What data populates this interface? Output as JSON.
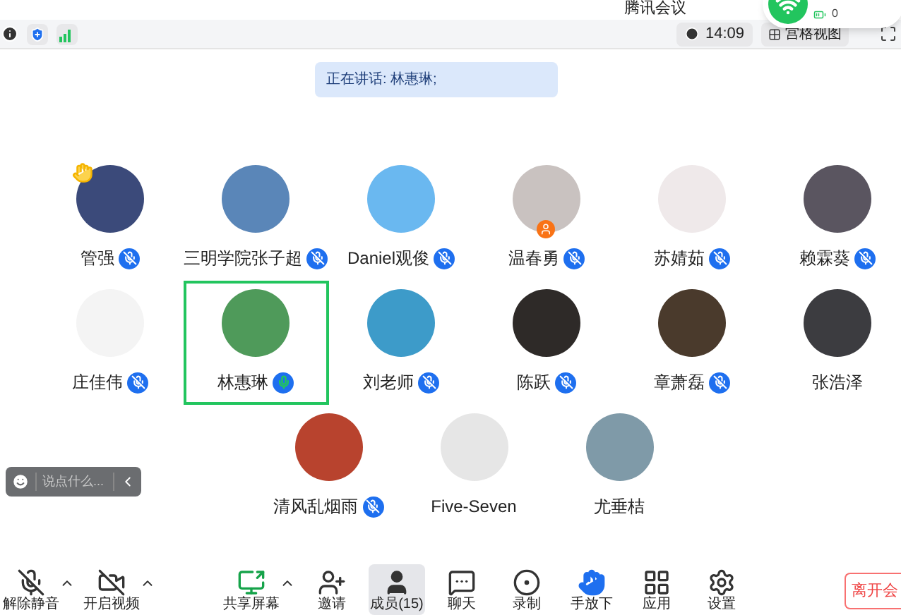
{
  "window": {
    "title": "腾讯会议"
  },
  "top_bar": {
    "time": "14:09",
    "view_button": "宫格视图"
  },
  "network_popup": {
    "count": "0"
  },
  "speaking_banner": "正在讲话: 林惠琳;",
  "participants": [
    {
      "name": "管强",
      "muted": true,
      "speaking": false,
      "selected": false,
      "hand_raised": true,
      "host": false,
      "color": "#3b4a7a"
    },
    {
      "name": "三明学院张子超",
      "muted": true,
      "speaking": false,
      "selected": false,
      "hand_raised": false,
      "host": false,
      "color": "#5a86b8"
    },
    {
      "name": "Daniel观俊",
      "muted": true,
      "speaking": false,
      "selected": false,
      "hand_raised": false,
      "host": false,
      "color": "#6ab8f0"
    },
    {
      "name": "温春勇",
      "muted": true,
      "speaking": false,
      "selected": false,
      "hand_raised": false,
      "host": true,
      "color": "#c9c2c0"
    },
    {
      "name": "苏婧茹",
      "muted": true,
      "speaking": false,
      "selected": false,
      "hand_raised": false,
      "host": false,
      "color": "#efe9ea"
    },
    {
      "name": "赖霖葵",
      "muted": true,
      "speaking": false,
      "selected": false,
      "hand_raised": false,
      "host": false,
      "color": "#5a5560"
    },
    {
      "name": "庄佳伟",
      "muted": true,
      "speaking": false,
      "selected": false,
      "hand_raised": false,
      "host": false,
      "color": "#f4f4f4"
    },
    {
      "name": "林惠琳",
      "muted": false,
      "speaking": true,
      "selected": true,
      "hand_raised": false,
      "host": false,
      "color": "#4f9a5a"
    },
    {
      "name": "刘老师",
      "muted": true,
      "speaking": false,
      "selected": false,
      "hand_raised": false,
      "host": false,
      "color": "#3d9bc9"
    },
    {
      "name": "陈跃",
      "muted": true,
      "speaking": false,
      "selected": false,
      "hand_raised": false,
      "host": false,
      "color": "#2e2a28"
    },
    {
      "name": "章萧磊",
      "muted": true,
      "speaking": false,
      "selected": false,
      "hand_raised": false,
      "host": false,
      "color": "#4a3a2c"
    },
    {
      "name": "张浩泽",
      "muted": false,
      "speaking": false,
      "selected": false,
      "hand_raised": false,
      "host": false,
      "color": "#3c3c40"
    },
    {
      "name": "清风乱烟雨",
      "muted": true,
      "speaking": false,
      "selected": false,
      "hand_raised": false,
      "host": false,
      "color": "#b8432e"
    },
    {
      "name": "Five-Seven",
      "muted": false,
      "speaking": false,
      "selected": false,
      "hand_raised": false,
      "host": false,
      "color": "#e6e6e6"
    },
    {
      "name": "尤垂桔",
      "muted": false,
      "speaking": false,
      "selected": false,
      "hand_raised": false,
      "host": false,
      "color": "#7f9aa8"
    }
  ],
  "chat_box": {
    "placeholder": "说点什么..."
  },
  "toolbar": [
    {
      "kind": "mic",
      "label": "解除静音",
      "caret": true,
      "selected": false
    },
    {
      "kind": "video",
      "label": "开启视频",
      "caret": true,
      "selected": false
    },
    {
      "kind": "share",
      "label": "共享屏幕",
      "caret": true,
      "selected": false
    },
    {
      "kind": "invite",
      "label": "邀请",
      "caret": false,
      "selected": false
    },
    {
      "kind": "members",
      "label": "成员(15)",
      "caret": false,
      "selected": true
    },
    {
      "kind": "chat",
      "label": "聊天",
      "caret": false,
      "selected": false
    },
    {
      "kind": "record",
      "label": "录制",
      "caret": false,
      "selected": false
    },
    {
      "kind": "hand",
      "label": "手放下",
      "caret": false,
      "selected": false
    },
    {
      "kind": "apps",
      "label": "应用",
      "caret": false,
      "selected": false
    },
    {
      "kind": "settings",
      "label": "设置",
      "caret": false,
      "selected": false
    }
  ],
  "leave_button": "离开会"
}
